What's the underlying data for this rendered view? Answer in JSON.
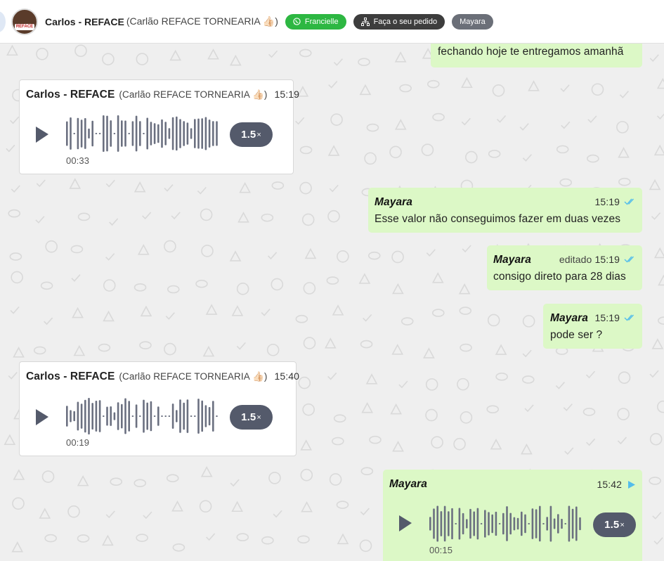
{
  "header": {
    "contact_name": "Carlos - REFACE",
    "contact_alias": "(Carlão REFACE TORNEARIA 👍🏻)",
    "avatar_logo": "REFACE",
    "chips": [
      {
        "label": "Francielle",
        "icon": "whatsapp-icon",
        "color": "#2db742"
      },
      {
        "label": "Faça o seu pedido",
        "icon": "sitemap-icon",
        "color": "#3d3d3d"
      },
      {
        "label": "Mayara",
        "icon": "",
        "color": "#6b6f78"
      }
    ]
  },
  "messages": [
    {
      "type": "text",
      "direction": "out",
      "text": "fechando hoje te entregamos amanhã"
    },
    {
      "type": "audio",
      "direction": "in",
      "sender": "Carlos - REFACE",
      "alias": "(Carlão REFACE TORNEARIA 👍🏻)",
      "time": "15:19",
      "duration": "00:33",
      "speed": "1.5",
      "speed_suffix": "×"
    },
    {
      "type": "text",
      "direction": "out",
      "sender": "Mayara",
      "time": "15:19",
      "text": "Esse valor não conseguimos fazer em duas vezes",
      "status": "read-ticks-icon"
    },
    {
      "type": "text",
      "direction": "out",
      "sender": "Mayara",
      "edited_label": "editado",
      "time": "15:19",
      "text": "consigo direto para 28 dias",
      "status": "read-ticks-icon"
    },
    {
      "type": "text",
      "direction": "out",
      "sender": "Mayara",
      "time": "15:19",
      "text": "pode ser ?",
      "status": "read-ticks-icon"
    },
    {
      "type": "audio",
      "direction": "in",
      "sender": "Carlos - REFACE",
      "alias": "(Carlão REFACE TORNEARIA 👍🏻)",
      "time": "15:40",
      "duration": "00:19",
      "speed": "1.5",
      "speed_suffix": "×"
    },
    {
      "type": "audio",
      "direction": "out",
      "sender": "Mayara",
      "time": "15:42",
      "duration": "00:15",
      "speed": "1.5",
      "speed_suffix": "×",
      "status": "played-triangle-icon"
    }
  ],
  "colors": {
    "outgoing_bubble": "#dcf8c6",
    "incoming_bubble": "#ffffff",
    "tick_blue": "#53bdeb",
    "speed_button": "#545a6b"
  }
}
